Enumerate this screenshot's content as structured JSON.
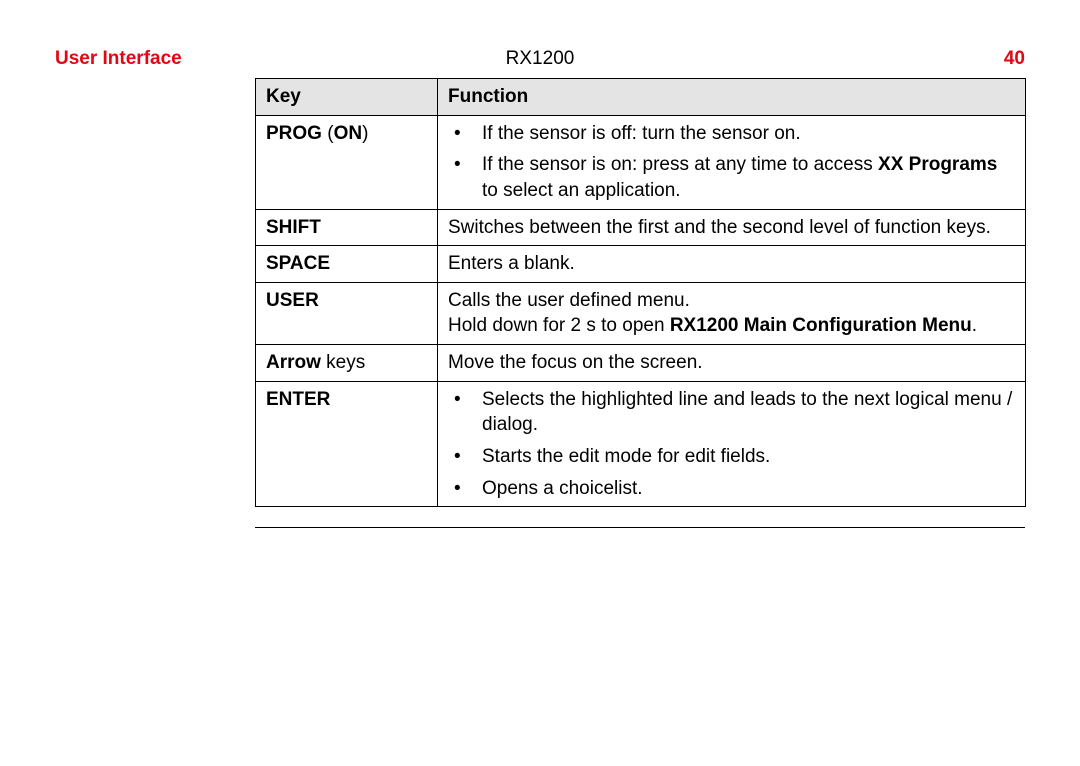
{
  "header": {
    "section": "User Interface",
    "model": "RX1200",
    "page_number": "40"
  },
  "table": {
    "columns": {
      "key": "Key",
      "function": "Function"
    },
    "rows": {
      "prog_on": {
        "key_pre": "PROG ",
        "key_paren": "(",
        "key_on": "ON",
        "key_paren_close": ")",
        "b1": "If the sensor is off: turn the sensor on.",
        "b2_a": "If the sensor is on: press at any time to access ",
        "b2_xx": "XX",
        "b2_b": " ",
        "b2_programs": "Programs",
        "b2_c": " to select an application."
      },
      "shift": {
        "key": "SHIFT",
        "func": "Switches between the first and the second level of function keys."
      },
      "space": {
        "key": "SPACE",
        "func": "Enters a blank."
      },
      "user": {
        "key": "USER",
        "func_a": "Calls the user defined menu.",
        "func_b_pre": "Hold down for 2 s to open ",
        "func_b_bold": "RX1200 Main Configuration Menu",
        "func_b_post": "."
      },
      "arrow": {
        "key_bold": "Arrow",
        "key_rest": " keys",
        "func": "Move the focus on the screen."
      },
      "enter": {
        "key": "ENTER",
        "b1": "Selects the highlighted line and leads to the next logical menu / dialog.",
        "b2": "Starts the edit mode for edit fields.",
        "b3": "Opens a choicelist."
      }
    }
  }
}
